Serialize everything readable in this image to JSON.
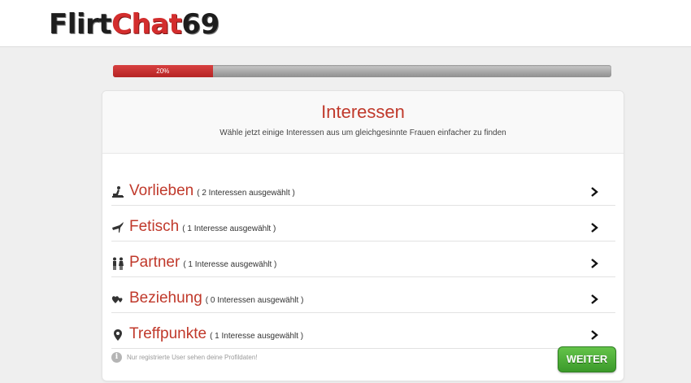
{
  "header": {
    "logo_part1": "Flirt",
    "logo_part2": "Chat",
    "logo_part3": "69"
  },
  "progress": {
    "label": "20%",
    "value": 0.2
  },
  "card": {
    "title": "Interessen",
    "subtitle": "Wähle jetzt einige Interessen aus um gleichgesinnte Frauen einfacher zu finden",
    "rows": [
      {
        "icon": "pose-icon",
        "name": "Vorlieben",
        "count": "( 2 Interessen ausgewählt )"
      },
      {
        "icon": "heel-icon",
        "name": "Fetisch",
        "count": "( 1 Interesse ausgewählt )"
      },
      {
        "icon": "couple-icon",
        "name": "Partner",
        "count": "( 1 Interesse ausgewählt )"
      },
      {
        "icon": "hearts-icon",
        "name": "Beziehung",
        "count": "( 0 Interessen ausgewählt )"
      },
      {
        "icon": "map-marker-icon",
        "name": "Treffpunkte",
        "count": "( 1 Interesse ausgewählt )"
      }
    ],
    "footer_note": "Nur registrierte User sehen deine Profildaten!",
    "button_label": "WEITER"
  },
  "colors": {
    "accent_red": "#c0392b",
    "button_green": "#4caf3a",
    "progress_red": "#c93232"
  }
}
